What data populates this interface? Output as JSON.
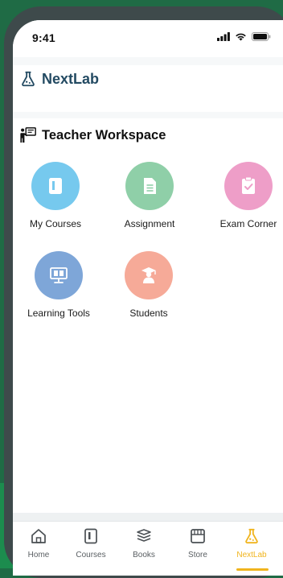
{
  "status_bar": {
    "time": "9:41"
  },
  "app": {
    "brand_name": "NextLab"
  },
  "workspace": {
    "title": "Teacher Workspace",
    "tiles": [
      {
        "label": "My Courses",
        "color": "#76c9ee",
        "icon": "book-icon"
      },
      {
        "label": "Assignment",
        "color": "#8fcfa8",
        "icon": "document-icon"
      },
      {
        "label": "Exam Corner",
        "color": "#ee9ec8",
        "icon": "clipboard-check-icon"
      },
      {
        "label": "Learning Tools",
        "color": "#7ea6d8",
        "icon": "monitor-book-icon"
      },
      {
        "label": "Students",
        "color": "#f6aa98",
        "icon": "graduate-icon"
      }
    ]
  },
  "tabbar": {
    "active": "NextLab",
    "active_color": "#f0b41d",
    "tabs": [
      {
        "label": "Home",
        "icon": "home-icon"
      },
      {
        "label": "Courses",
        "icon": "book-icon"
      },
      {
        "label": "Books",
        "icon": "books-stack-icon"
      },
      {
        "label": "Store",
        "icon": "store-icon"
      },
      {
        "label": "NextLab",
        "icon": "flask-icon"
      }
    ]
  }
}
